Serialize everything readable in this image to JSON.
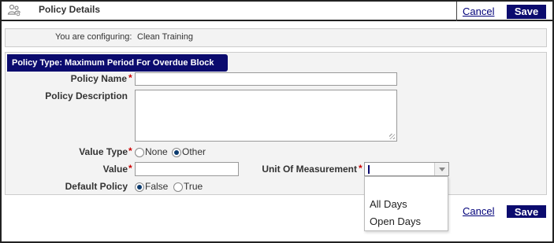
{
  "header": {
    "title": "Policy Details",
    "icon": "people-settings-icon",
    "cancel_label": "Cancel",
    "save_label": "Save"
  },
  "config": {
    "label": "You are configuring:",
    "value": "Clean Training"
  },
  "panel": {
    "title": "Policy Type: Maximum Period For Overdue Block"
  },
  "form": {
    "policy_name_label": "Policy Name",
    "policy_name_value": "",
    "policy_description_label": "Policy Description",
    "policy_description_value": "",
    "value_type_label": "Value Type",
    "value_type_options": [
      "None",
      "Other"
    ],
    "value_type_selected": "Other",
    "value_label": "Value",
    "value_value": "",
    "unit_label": "Unit Of Measurement",
    "unit_value": "",
    "unit_options": [
      "",
      "All Days",
      "Open Days"
    ],
    "default_policy_label": "Default Policy",
    "default_policy_options": [
      "False",
      "True"
    ],
    "default_policy_selected": "False",
    "required_mark": "*"
  },
  "footer": {
    "cancel_label": "Cancel",
    "save_label": "Save"
  },
  "colors": {
    "accent": "#0b0b6e",
    "required": "#cc0000",
    "panel_bg": "#f3f3f3"
  }
}
